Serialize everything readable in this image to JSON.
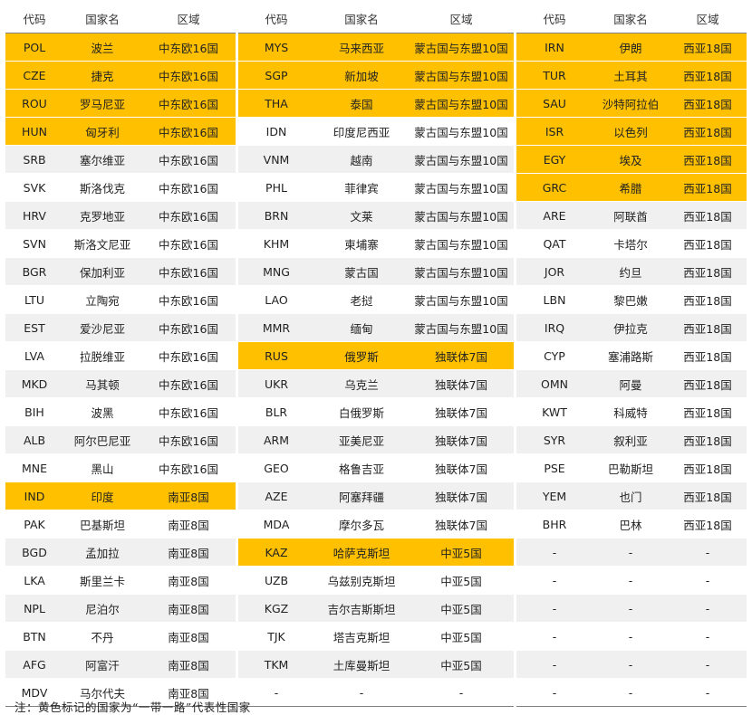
{
  "headers": [
    "代码",
    "国家名",
    "区域"
  ],
  "groups": [
    {
      "rows": [
        {
          "code": "POL",
          "name": "波兰",
          "region": "中东欧16国",
          "hl": true
        },
        {
          "code": "CZE",
          "name": "捷克",
          "region": "中东欧16国",
          "hl": true
        },
        {
          "code": "ROU",
          "name": "罗马尼亚",
          "region": "中东欧16国",
          "hl": true
        },
        {
          "code": "HUN",
          "name": "匈牙利",
          "region": "中东欧16国",
          "hl": true
        },
        {
          "code": "SRB",
          "name": "塞尔维亚",
          "region": "中东欧16国",
          "hl": false
        },
        {
          "code": "SVK",
          "name": "斯洛伐克",
          "region": "中东欧16国",
          "hl": false
        },
        {
          "code": "HRV",
          "name": "克罗地亚",
          "region": "中东欧16国",
          "hl": false
        },
        {
          "code": "SVN",
          "name": "斯洛文尼亚",
          "region": "中东欧16国",
          "hl": false
        },
        {
          "code": "BGR",
          "name": "保加利亚",
          "region": "中东欧16国",
          "hl": false
        },
        {
          "code": "LTU",
          "name": "立陶宛",
          "region": "中东欧16国",
          "hl": false
        },
        {
          "code": "EST",
          "name": "爱沙尼亚",
          "region": "中东欧16国",
          "hl": false
        },
        {
          "code": "LVA",
          "name": "拉脱维亚",
          "region": "中东欧16国",
          "hl": false
        },
        {
          "code": "MKD",
          "name": "马其顿",
          "region": "中东欧16国",
          "hl": false
        },
        {
          "code": "BIH",
          "name": "波黑",
          "region": "中东欧16国",
          "hl": false
        },
        {
          "code": "ALB",
          "name": "阿尔巴尼亚",
          "region": "中东欧16国",
          "hl": false
        },
        {
          "code": "MNE",
          "name": "黑山",
          "region": "中东欧16国",
          "hl": false
        },
        {
          "code": "IND",
          "name": "印度",
          "region": "南亚8国",
          "hl": true
        },
        {
          "code": "PAK",
          "name": "巴基斯坦",
          "region": "南亚8国",
          "hl": false
        },
        {
          "code": "BGD",
          "name": "孟加拉",
          "region": "南亚8国",
          "hl": false
        },
        {
          "code": "LKA",
          "name": "斯里兰卡",
          "region": "南亚8国",
          "hl": false
        },
        {
          "code": "NPL",
          "name": "尼泊尔",
          "region": "南亚8国",
          "hl": false
        },
        {
          "code": "BTN",
          "name": "不丹",
          "region": "南亚8国",
          "hl": false
        },
        {
          "code": "AFG",
          "name": "阿富汗",
          "region": "南亚8国",
          "hl": false
        },
        {
          "code": "MDV",
          "name": "马尔代夫",
          "region": "南亚8国",
          "hl": false
        }
      ]
    },
    {
      "rows": [
        {
          "code": "MYS",
          "name": "马来西亚",
          "region": "蒙古国与东盟10国",
          "hl": true
        },
        {
          "code": "SGP",
          "name": "新加坡",
          "region": "蒙古国与东盟10国",
          "hl": true
        },
        {
          "code": "THA",
          "name": "泰国",
          "region": "蒙古国与东盟10国",
          "hl": true
        },
        {
          "code": "IDN",
          "name": "印度尼西亚",
          "region": "蒙古国与东盟10国",
          "hl": false
        },
        {
          "code": "VNM",
          "name": "越南",
          "region": "蒙古国与东盟10国",
          "hl": false
        },
        {
          "code": "PHL",
          "name": "菲律宾",
          "region": "蒙古国与东盟10国",
          "hl": false
        },
        {
          "code": "BRN",
          "name": "文莱",
          "region": "蒙古国与东盟10国",
          "hl": false
        },
        {
          "code": "KHM",
          "name": "柬埔寨",
          "region": "蒙古国与东盟10国",
          "hl": false
        },
        {
          "code": "MNG",
          "name": "蒙古国",
          "region": "蒙古国与东盟10国",
          "hl": false
        },
        {
          "code": "LAO",
          "name": "老挝",
          "region": "蒙古国与东盟10国",
          "hl": false
        },
        {
          "code": "MMR",
          "name": "缅甸",
          "region": "蒙古国与东盟10国",
          "hl": false
        },
        {
          "code": "RUS",
          "name": "俄罗斯",
          "region": "独联体7国",
          "hl": true
        },
        {
          "code": "UKR",
          "name": "乌克兰",
          "region": "独联体7国",
          "hl": false
        },
        {
          "code": "BLR",
          "name": "白俄罗斯",
          "region": "独联体7国",
          "hl": false
        },
        {
          "code": "ARM",
          "name": "亚美尼亚",
          "region": "独联体7国",
          "hl": false
        },
        {
          "code": "GEO",
          "name": "格鲁吉亚",
          "region": "独联体7国",
          "hl": false
        },
        {
          "code": "AZE",
          "name": "阿塞拜疆",
          "region": "独联体7国",
          "hl": false
        },
        {
          "code": "MDA",
          "name": "摩尔多瓦",
          "region": "独联体7国",
          "hl": false
        },
        {
          "code": "KAZ",
          "name": "哈萨克斯坦",
          "region": "中亚5国",
          "hl": true
        },
        {
          "code": "UZB",
          "name": "乌兹别克斯坦",
          "region": "中亚5国",
          "hl": false
        },
        {
          "code": "KGZ",
          "name": "吉尔吉斯斯坦",
          "region": "中亚5国",
          "hl": false
        },
        {
          "code": "TJK",
          "name": "塔吉克斯坦",
          "region": "中亚5国",
          "hl": false
        },
        {
          "code": "TKM",
          "name": "土库曼斯坦",
          "region": "中亚5国",
          "hl": false
        },
        {
          "code": "-",
          "name": "-",
          "region": "-",
          "hl": false
        }
      ]
    },
    {
      "rows": [
        {
          "code": "IRN",
          "name": "伊朗",
          "region": "西亚18国",
          "hl": true
        },
        {
          "code": "TUR",
          "name": "土耳其",
          "region": "西亚18国",
          "hl": true
        },
        {
          "code": "SAU",
          "name": "沙特阿拉伯",
          "region": "西亚18国",
          "hl": true
        },
        {
          "code": "ISR",
          "name": "以色列",
          "region": "西亚18国",
          "hl": true
        },
        {
          "code": "EGY",
          "name": "埃及",
          "region": "西亚18国",
          "hl": true
        },
        {
          "code": "GRC",
          "name": "希腊",
          "region": "西亚18国",
          "hl": true
        },
        {
          "code": "ARE",
          "name": "阿联酋",
          "region": "西亚18国",
          "hl": false
        },
        {
          "code": "QAT",
          "name": "卡塔尔",
          "region": "西亚18国",
          "hl": false
        },
        {
          "code": "JOR",
          "name": "约旦",
          "region": "西亚18国",
          "hl": false
        },
        {
          "code": "LBN",
          "name": "黎巴嫩",
          "region": "西亚18国",
          "hl": false
        },
        {
          "code": "IRQ",
          "name": "伊拉克",
          "region": "西亚18国",
          "hl": false
        },
        {
          "code": "CYP",
          "name": "塞浦路斯",
          "region": "西亚18国",
          "hl": false
        },
        {
          "code": "OMN",
          "name": "阿曼",
          "region": "西亚18国",
          "hl": false
        },
        {
          "code": "KWT",
          "name": "科威特",
          "region": "西亚18国",
          "hl": false
        },
        {
          "code": "SYR",
          "name": "叙利亚",
          "region": "西亚18国",
          "hl": false
        },
        {
          "code": "PSE",
          "name": "巴勒斯坦",
          "region": "西亚18国",
          "hl": false
        },
        {
          "code": "YEM",
          "name": "也门",
          "region": "西亚18国",
          "hl": false
        },
        {
          "code": "BHR",
          "name": "巴林",
          "region": "西亚18国",
          "hl": false
        },
        {
          "code": "-",
          "name": "-",
          "region": "-",
          "hl": false
        },
        {
          "code": "-",
          "name": "-",
          "region": "-",
          "hl": false
        },
        {
          "code": "-",
          "name": "-",
          "region": "-",
          "hl": false
        },
        {
          "code": "-",
          "name": "-",
          "region": "-",
          "hl": false
        },
        {
          "code": "-",
          "name": "-",
          "region": "-",
          "hl": false
        },
        {
          "code": "-",
          "name": "-",
          "region": "-",
          "hl": false
        }
      ]
    }
  ],
  "note": "注：黄色标记的国家为“一带一路”代表性国家"
}
